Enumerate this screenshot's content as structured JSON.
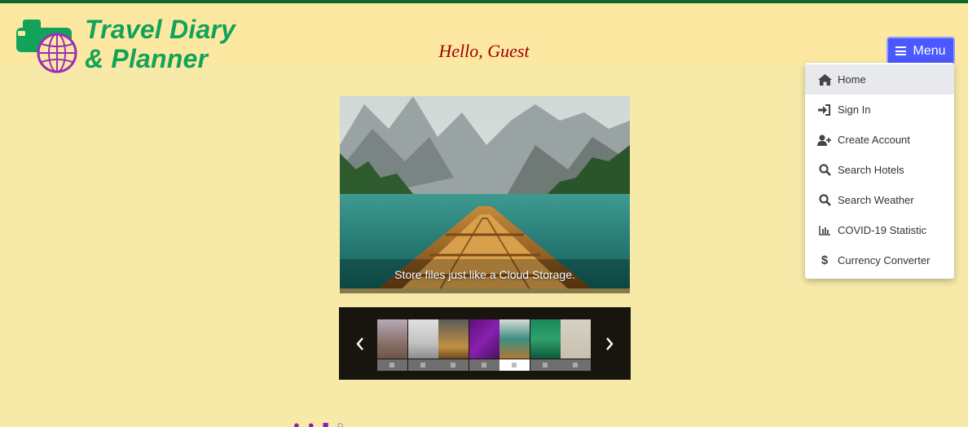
{
  "header": {
    "logo_line1": "Travel Diary",
    "logo_line2": "& Planner",
    "greeting": "Hello, Guest",
    "menu_label": "Menu"
  },
  "menu": {
    "items": [
      {
        "label": "Home",
        "icon": "home-icon",
        "active": true
      },
      {
        "label": "Sign In",
        "icon": "sign-in-icon"
      },
      {
        "label": "Create Account",
        "icon": "user-plus-icon"
      },
      {
        "label": "Search Hotels",
        "icon": "search-icon"
      },
      {
        "label": "Search Weather",
        "icon": "search-icon"
      },
      {
        "label": "COVID-19 Statistic",
        "icon": "bar-chart-icon"
      },
      {
        "label": "Currency Converter",
        "icon": "dollar-icon"
      }
    ]
  },
  "carousel": {
    "caption": "Store files just like a Cloud Storage.",
    "active_slide": 5,
    "slide_count": 7
  },
  "colors": {
    "page_bg": "#f7e9a8",
    "header_bg": "#fde8a2",
    "logo_green": "#12a25a",
    "greeting_red": "#a40000",
    "menu_button": "#4b57ff",
    "footer_purple": "#8a1fb0"
  }
}
